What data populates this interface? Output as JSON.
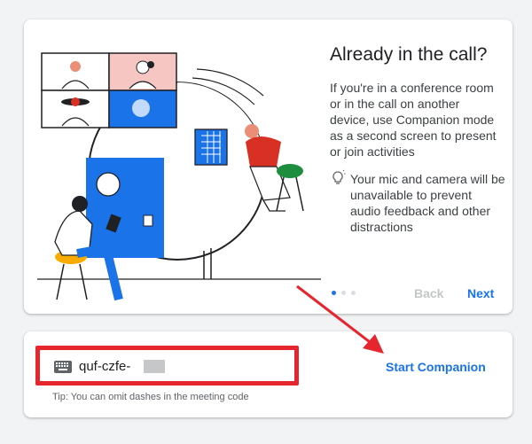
{
  "slide": {
    "title": "Already in the call?",
    "description": "If you're in a conference room or in the call on another device, use Companion mode as a second screen to present or join activities",
    "note": "Your mic and camera will be unavailable to prevent audio feedback and other distractions",
    "note_icon": "lightbulb-icon",
    "back_label": "Back",
    "next_label": "Next",
    "page_count": 3,
    "active_page": 1
  },
  "companion": {
    "code_value": "quf-czfe-",
    "keyboard_icon": "keyboard-icon",
    "tip": "Tip: You can omit dashes in the meeting code",
    "start_label": "Start Companion"
  },
  "colors": {
    "accent": "#1a73e8",
    "highlight_red": "#e5262e",
    "disabled": "#c4c7c5"
  }
}
